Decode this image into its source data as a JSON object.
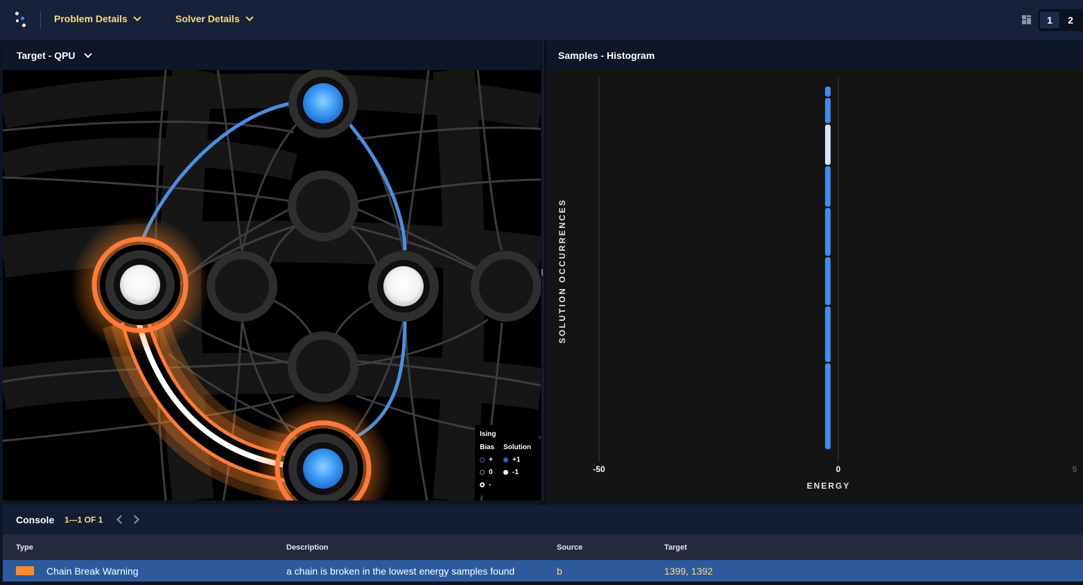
{
  "topbar": {
    "menu_problem": "Problem Details",
    "menu_solver": "Solver Details",
    "pages": [
      "1",
      "2"
    ]
  },
  "left_panel": {
    "title": "Target - QPU"
  },
  "legend": {
    "title": "Ising",
    "bias_label": "Bias",
    "solution_label": "Solution",
    "bias_plus": "+",
    "bias_zero": "0",
    "bias_minus": "-",
    "sol_plus": "+1",
    "sol_minus": "-1"
  },
  "right_panel": {
    "title": "Samples - Histogram"
  },
  "chart_data": {
    "type": "bar",
    "xlabel": "ENERGY",
    "ylabel": "SOLUTION OCCURRENCES",
    "x_ticks": [
      "-50",
      "0",
      "5"
    ],
    "bars": [
      {
        "energy": 0,
        "segments": 8
      }
    ]
  },
  "console": {
    "title": "Console",
    "count": "1—1 OF 1",
    "columns": [
      "Type",
      "Description",
      "Source",
      "Target"
    ],
    "rows": [
      {
        "type": "Chain Break Warning",
        "description": "a chain is broken in the lowest energy samples found",
        "source": "b",
        "target": "1399, 1392",
        "color": "#ff8a2a"
      }
    ]
  },
  "colors": {
    "accent_yellow": "#ffd97a",
    "qubit_blue": "#3d8ef0",
    "chain_orange": "#ff7a3a",
    "selected_row": "#2c5a9c"
  }
}
